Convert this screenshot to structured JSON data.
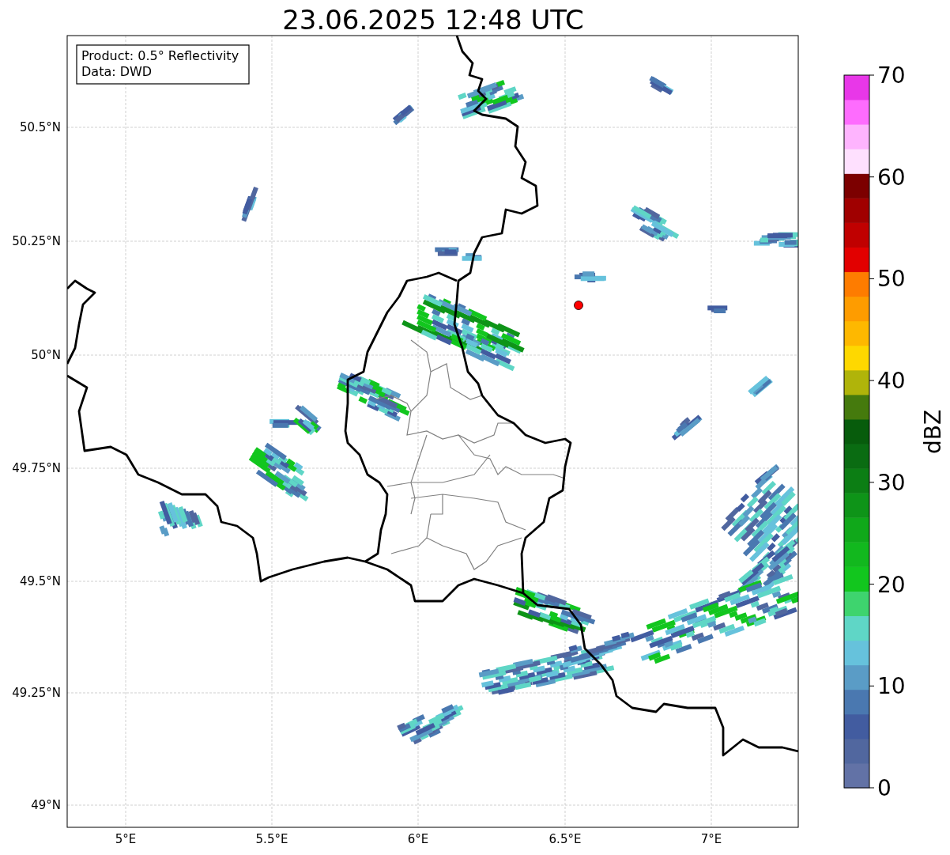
{
  "title": "23.06.2025 12:48 UTC",
  "legend": [
    "Product: 0.5° Reflectivity",
    "Data: DWD"
  ],
  "lat_ticks": [
    "50.5°N",
    "50.25°N",
    "50°N",
    "49.75°N",
    "49.5°N",
    "49.25°N",
    "49°N"
  ],
  "lon_ticks": [
    "5°E",
    "5.5°E",
    "6°E",
    "6.5°E",
    "7°E"
  ],
  "colorbar": {
    "label": "dBZ",
    "ticks": [
      "70",
      "60",
      "50",
      "40",
      "30",
      "20",
      "10",
      "0"
    ],
    "bands": [
      {
        "color": "#6272a6"
      },
      {
        "color": "#51679f"
      },
      {
        "color": "#425ca0"
      },
      {
        "color": "#4a78b0"
      },
      {
        "color": "#5a9cc6"
      },
      {
        "color": "#66c2dc"
      },
      {
        "color": "#5fd6c6"
      },
      {
        "color": "#3ed46e"
      },
      {
        "color": "#12c61e"
      },
      {
        "color": "#12b81e"
      },
      {
        "color": "#10a81a"
      },
      {
        "color": "#0e9418"
      },
      {
        "color": "#0c7e14"
      },
      {
        "color": "#0a6c12"
      },
      {
        "color": "#075c0c"
      },
      {
        "color": "#457a0d"
      },
      {
        "color": "#b0b40a"
      },
      {
        "color": "#fed800"
      },
      {
        "color": "#feb800"
      },
      {
        "color": "#fe9c00"
      },
      {
        "color": "#fe7c00"
      },
      {
        "color": "#e20000"
      },
      {
        "color": "#c00000"
      },
      {
        "color": "#a00000"
      },
      {
        "color": "#7c0000"
      },
      {
        "color": "#fee0fe"
      },
      {
        "color": "#feb4fe"
      },
      {
        "color": "#fe6cfe"
      },
      {
        "color": "#e837e8"
      }
    ]
  }
}
